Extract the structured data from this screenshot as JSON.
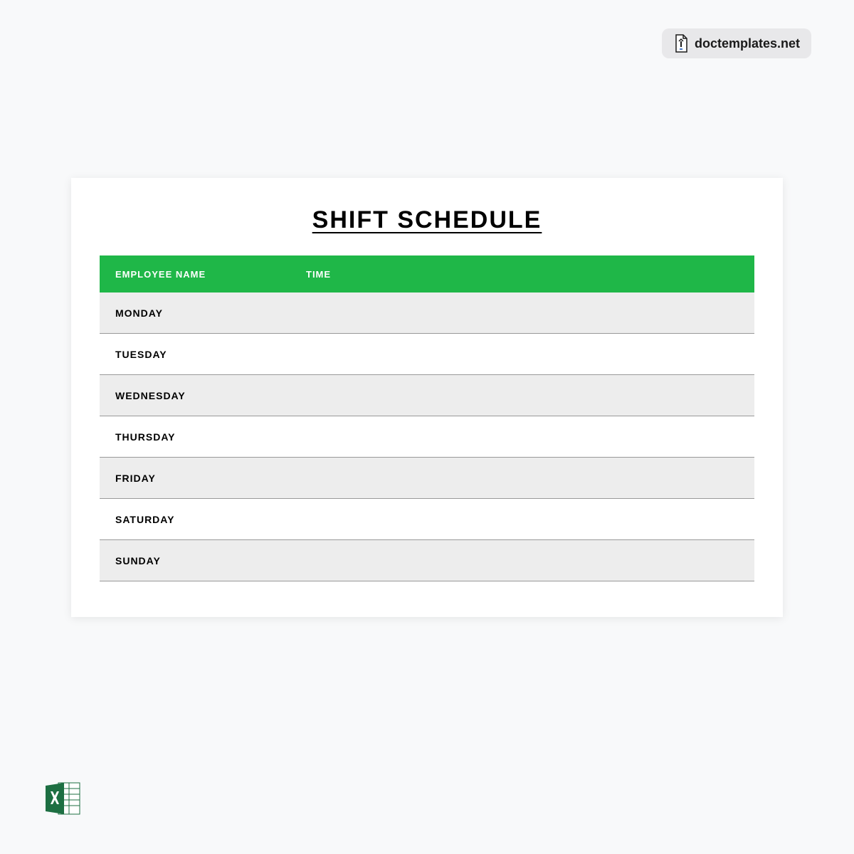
{
  "watermark": {
    "text": "doctemplates.net"
  },
  "document": {
    "title": "SHIFT SCHEDULE",
    "headers": {
      "col1": "EMPLOYEE  NAME",
      "col2": "TIME"
    },
    "days": [
      {
        "label": "MONDAY",
        "shaded": true
      },
      {
        "label": "TUESDAY",
        "shaded": false
      },
      {
        "label": "WEDNESDAY",
        "shaded": true
      },
      {
        "label": "THURSDAY",
        "shaded": false
      },
      {
        "label": "FRIDAY",
        "shaded": true
      },
      {
        "label": "SATURDAY",
        "shaded": false
      },
      {
        "label": "SUNDAY",
        "shaded": true
      }
    ]
  },
  "colors": {
    "header_green": "#1fb748",
    "row_gray": "#ededed",
    "page_bg": "#f8f9fa",
    "excel_green": "#1d6f42"
  }
}
